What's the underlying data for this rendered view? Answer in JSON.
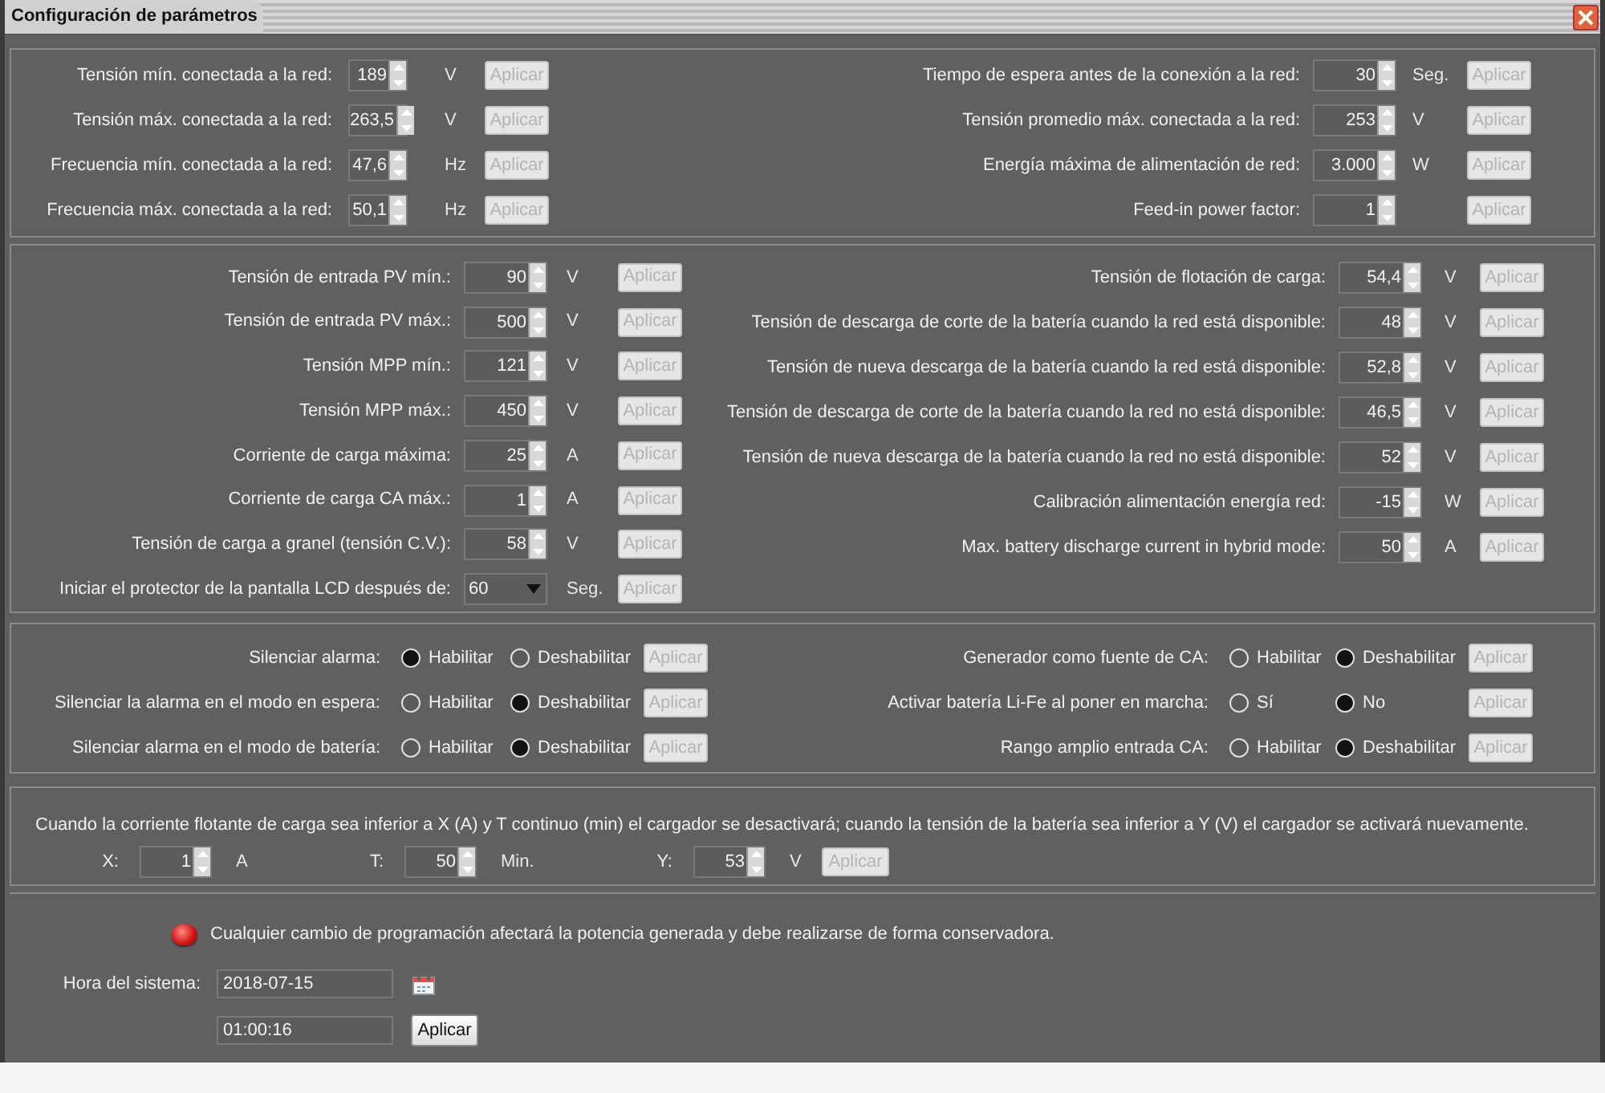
{
  "window": {
    "title": "Configuración de parámetros"
  },
  "grid_settings": {
    "left": [
      {
        "kind": "spinner",
        "label": "Tensión mín. conectada a la red:",
        "value": "189",
        "unit": "V",
        "button": {
          "label": "Aplicar",
          "disabled": true
        }
      },
      {
        "kind": "spinner",
        "label": "Tensión máx. conectada a la red:",
        "value": "263,5",
        "unit": "V",
        "button": {
          "label": "Aplicar",
          "disabled": true
        }
      },
      {
        "kind": "spinner",
        "label": "Frecuencia mín. conectada a la red:",
        "value": "47,6",
        "unit": "Hz",
        "button": {
          "label": "Aplicar",
          "disabled": true
        }
      },
      {
        "kind": "spinner",
        "label": "Frecuencia máx. conectada a la red:",
        "value": "50,1",
        "unit": "Hz",
        "button": {
          "label": "Aplicar",
          "disabled": true
        }
      }
    ],
    "right": [
      {
        "kind": "spinner",
        "label": "Tiempo de espera antes de la conexión a la red:",
        "value": "30",
        "unit": "Seg.",
        "button": {
          "label": "Aplicar",
          "disabled": true
        }
      },
      {
        "kind": "spinner",
        "label": "Tensión promedio máx. conectada a la red:",
        "value": "253",
        "unit": "V",
        "button": {
          "label": "Aplicar",
          "disabled": true
        }
      },
      {
        "kind": "spinner",
        "label": "Energía máxima de alimentación de red:",
        "value": "3.000",
        "unit": "W",
        "button": {
          "label": "Aplicar",
          "disabled": true
        }
      },
      {
        "kind": "spinner",
        "label": "Feed-in power factor:",
        "value": "1",
        "button": {
          "label": "Aplicar",
          "disabled": true
        }
      }
    ]
  },
  "battery_settings": {
    "left": [
      {
        "kind": "spinner",
        "label": "Tensión de entrada PV mín.:",
        "value": "90",
        "unit": "V",
        "button": {
          "label": "Aplicar",
          "disabled": true
        }
      },
      {
        "kind": "spinner",
        "label": "Tensión de entrada PV máx.:",
        "value": "500",
        "unit": "V",
        "button": {
          "label": "Aplicar",
          "disabled": true
        }
      },
      {
        "kind": "spinner",
        "label": "Tensión MPP mín.:",
        "value": "121",
        "unit": "V",
        "button": {
          "label": "Aplicar",
          "disabled": true
        }
      },
      {
        "kind": "spinner",
        "label": "Tensión MPP máx.:",
        "value": "450",
        "unit": "V",
        "button": {
          "label": "Aplicar",
          "disabled": true
        }
      },
      {
        "kind": "spinner",
        "label": "Corriente de carga máxima:",
        "value": "25",
        "unit": "A",
        "button": {
          "label": "Aplicar",
          "disabled": true
        }
      },
      {
        "kind": "spinner",
        "label": "Corriente de carga CA máx.:",
        "value": "1",
        "unit": "A",
        "button": {
          "label": "Aplicar",
          "disabled": true
        }
      },
      {
        "kind": "spinner",
        "label": "Tensión de carga a granel (tensión C.V.):",
        "value": "58",
        "unit": "V",
        "button": {
          "label": "Aplicar",
          "disabled": true
        }
      },
      {
        "kind": "dropdown",
        "label": "Iniciar el protector de la pantalla LCD después de:",
        "value": "60",
        "unit": "Seg.",
        "button": {
          "label": "Aplicar",
          "disabled": true
        }
      }
    ],
    "right": [
      {
        "kind": "spinner",
        "label": "Tensión de flotación de carga:",
        "value": "54,4",
        "unit": "V",
        "button": {
          "label": "Aplicar",
          "disabled": true
        }
      },
      {
        "kind": "spinner",
        "label": "Tensión de descarga de corte de la batería cuando la red está disponible:",
        "value": "48",
        "unit": "V",
        "button": {
          "label": "Aplicar",
          "disabled": true
        }
      },
      {
        "kind": "spinner",
        "label": "Tensión de nueva descarga de la batería cuando la red está disponible:",
        "value": "52,8",
        "unit": "V",
        "button": {
          "label": "Aplicar",
          "disabled": true
        }
      },
      {
        "kind": "spinner",
        "label": "Tensión de descarga de corte de la batería cuando la red no está disponible:",
        "value": "46,5",
        "unit": "V",
        "button": {
          "label": "Aplicar",
          "disabled": true
        }
      },
      {
        "kind": "spinner",
        "label": "Tensión de nueva descarga de la batería cuando la red no está disponible:",
        "value": "52",
        "unit": "V",
        "button": {
          "label": "Aplicar",
          "disabled": true
        }
      },
      {
        "kind": "spinner",
        "label": "Calibración alimentación energía red:",
        "value": "-15",
        "unit": "W",
        "button": {
          "label": "Aplicar",
          "disabled": true
        }
      },
      {
        "kind": "spinner",
        "label": "Max. battery discharge current in hybrid mode:",
        "value": "50",
        "unit": "A",
        "button": {
          "label": "Aplicar",
          "disabled": true
        }
      }
    ]
  },
  "switches": {
    "left": [
      {
        "label": "Silenciar alarma:",
        "options": [
          {
            "label": "Habilitar",
            "selected": true
          },
          {
            "label": "Deshabilitar",
            "selected": false
          }
        ],
        "button": {
          "label": "Aplicar",
          "disabled": true
        }
      },
      {
        "label": "Silenciar la alarma en el modo en espera:",
        "options": [
          {
            "label": "Habilitar",
            "selected": false
          },
          {
            "label": "Deshabilitar",
            "selected": true
          }
        ],
        "button": {
          "label": "Aplicar",
          "disabled": true
        }
      },
      {
        "label": "Silenciar alarma en el modo de batería:",
        "options": [
          {
            "label": "Habilitar",
            "selected": false
          },
          {
            "label": "Deshabilitar",
            "selected": true
          }
        ],
        "button": {
          "label": "Aplicar",
          "disabled": true
        }
      }
    ],
    "right": [
      {
        "label": "Generador como fuente de CA:",
        "options": [
          {
            "label": "Habilitar",
            "selected": false
          },
          {
            "label": "Deshabilitar",
            "selected": true
          }
        ],
        "button": {
          "label": "Aplicar",
          "disabled": true
        }
      },
      {
        "label": "Activar batería Li-Fe al poner en marcha:",
        "options": [
          {
            "label": "Sí",
            "selected": false
          },
          {
            "label": "No",
            "selected": true
          }
        ],
        "button": {
          "label": "Aplicar",
          "disabled": true
        }
      },
      {
        "label": "Rango amplio entrada CA:",
        "options": [
          {
            "label": "Habilitar",
            "selected": false
          },
          {
            "label": "Deshabilitar",
            "selected": true
          }
        ],
        "button": {
          "label": "Aplicar",
          "disabled": true
        }
      }
    ]
  },
  "charger_cutoff": {
    "description": "Cuando la corriente flotante de carga sea inferior a X (A) y T continuo (min) el cargador se desactivará; cuando la tensión de la batería sea inferior a Y (V) el cargador se activará nuevamente.",
    "fields": [
      {
        "label": "X:",
        "value": "1",
        "unit": "A"
      },
      {
        "label": "T:",
        "value": "50",
        "unit": "Min."
      },
      {
        "label": "Y:",
        "value": "53",
        "unit": "V"
      }
    ],
    "button": {
      "label": "Aplicar",
      "disabled": true
    }
  },
  "system_time": {
    "warning": "Cualquier cambio de programación afectará la potencia generada y debe realizarse de forma conservadora.",
    "label": "Hora del sistema:",
    "date": "2018-07-15",
    "time": "01:00:16",
    "button": {
      "label": "Aplicar",
      "disabled": false
    }
  }
}
